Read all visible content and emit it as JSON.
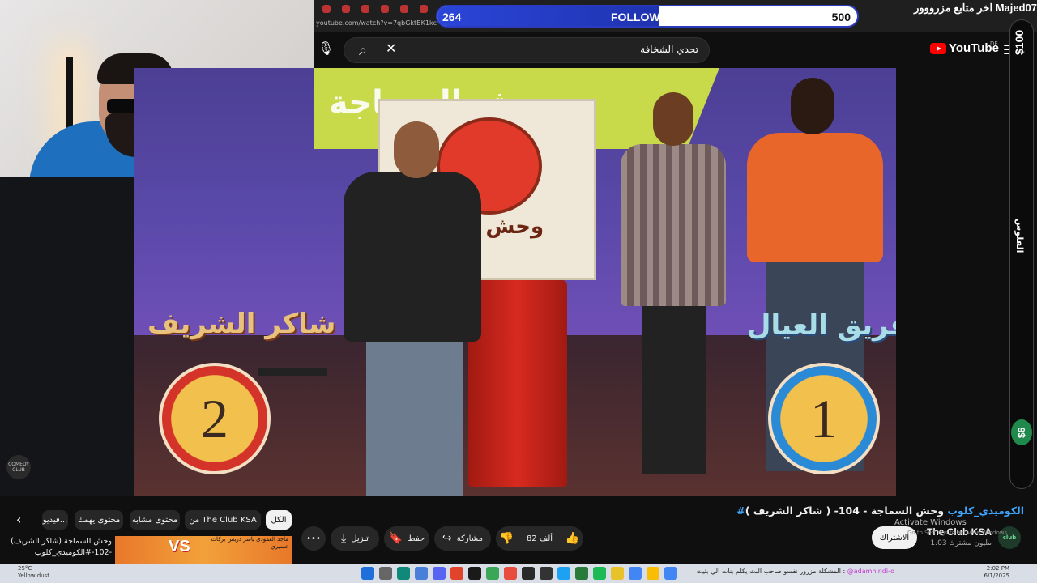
{
  "browser": {
    "url": "youtube.com/watch?v=7qbGktBK1kc"
  },
  "followers_bar": {
    "current": "264",
    "label": "FOLLOWERS",
    "goal": "500",
    "progress": 0.528
  },
  "last_follower": "اخر متابع مزرووور Majed07",
  "youtube": {
    "search_query": "تحدي الشخافة",
    "logo_text": "YouTube",
    "region": "DE"
  },
  "overlay": {
    "donation_top": "$100",
    "side_label": "الفلوس",
    "donation_bottom": "$6"
  },
  "video": {
    "team_left": "شاكر الشريف",
    "team_right": "فريق العيال",
    "score_left": "2",
    "score_right": "1",
    "banner_text": "وحش السماجة",
    "sign_text": "وحش ال",
    "title_main": "وحش السماجة - 104- ( شاكر الشريف )",
    "title_hashtag": "#الكوميدي_كلوب",
    "corner_logo": "COMEDY CLUB"
  },
  "channel": {
    "name": "The Club KSA",
    "subscribers": "1.03 مليون مشترك",
    "subscribe_label": "الاشتراك",
    "logo_text": "club"
  },
  "actions": {
    "likes": "82 ألف",
    "share": "مشاركة",
    "save": "حفظ",
    "download": "تنزيل",
    "more": "•••"
  },
  "chips": {
    "prev": "‹",
    "all": "الكل",
    "from_channel": "من The Club KSA",
    "related": "محتوى مشابه",
    "for_you": "محتوى يهمك",
    "videos": "فيديو..."
  },
  "related_video": {
    "title": "وحش السماجة (شاكر الشريف) -102-#الكوميدي_كلوب",
    "vs": "VS",
    "names": "ماجد العمودي  ياسر دريس  بركات عسيري"
  },
  "windows": {
    "activate_title": "Activate Windows",
    "activate_sub": "Go to Settings to activate Windows."
  },
  "taskbar": {
    "weather": "25°C",
    "weather_sub": "Yellow dust",
    "chat_user": "@adamhindi-o",
    "chat_message": "المشكلة مزرور نفسو صاحب البث يكلم بنات الي بثيث :",
    "time": "2:02 PM",
    "date": "6/1/2025"
  }
}
